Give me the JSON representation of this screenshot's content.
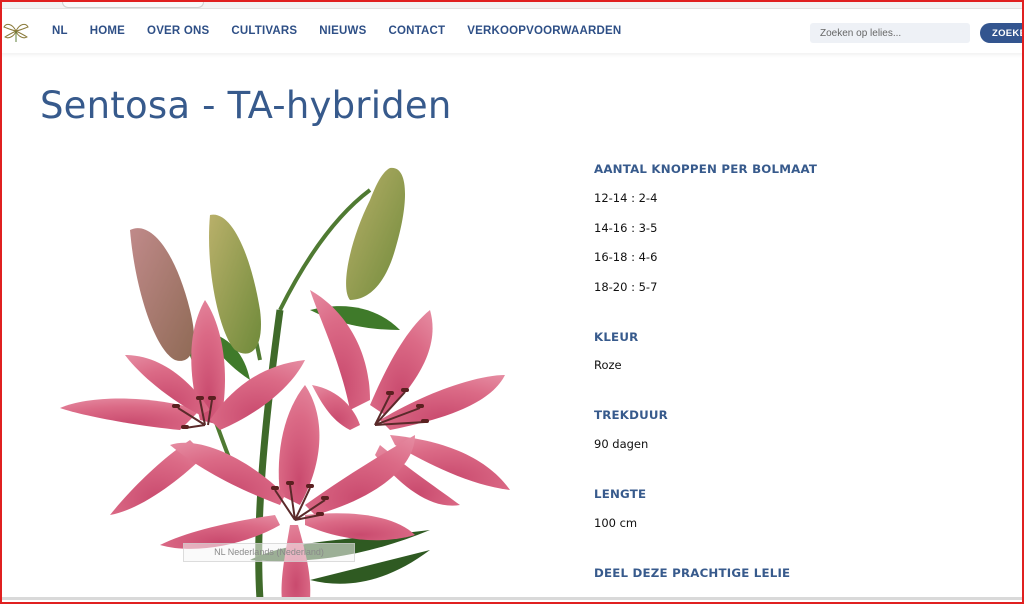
{
  "nav": {
    "items": [
      "NL",
      "HOME",
      "OVER ONS",
      "CULTIVARS",
      "NIEUWS",
      "CONTACT",
      "VERKOOPVOORWAARDEN"
    ]
  },
  "search": {
    "placeholder": "Zoeken op lelies...",
    "button_label": "ZOEKEN"
  },
  "page": {
    "title": "Sentosa - TA-hybriden"
  },
  "image_overlay": {
    "language_label": "NL Nederlands (Nederland)"
  },
  "details": {
    "knoppen": {
      "heading": "AANTAL KNOPPEN PER BOLMAAT",
      "values": [
        "12-14 : 2-4",
        "14-16 : 3-5",
        "16-18 : 4-6",
        "18-20 : 5-7"
      ]
    },
    "kleur": {
      "heading": "KLEUR",
      "value": "Roze"
    },
    "trekduur": {
      "heading": "TREKDUUR",
      "value": "90 dagen"
    },
    "lengte": {
      "heading": "LENGTE",
      "value": "100 cm"
    },
    "share": {
      "heading": "DEEL DEZE PRACHTIGE LELIE"
    }
  },
  "colors": {
    "brand_blue": "#375a8c",
    "nav_blue": "#2e4f86",
    "petal_pink": "#d9607e",
    "frame_red": "#e02020"
  }
}
